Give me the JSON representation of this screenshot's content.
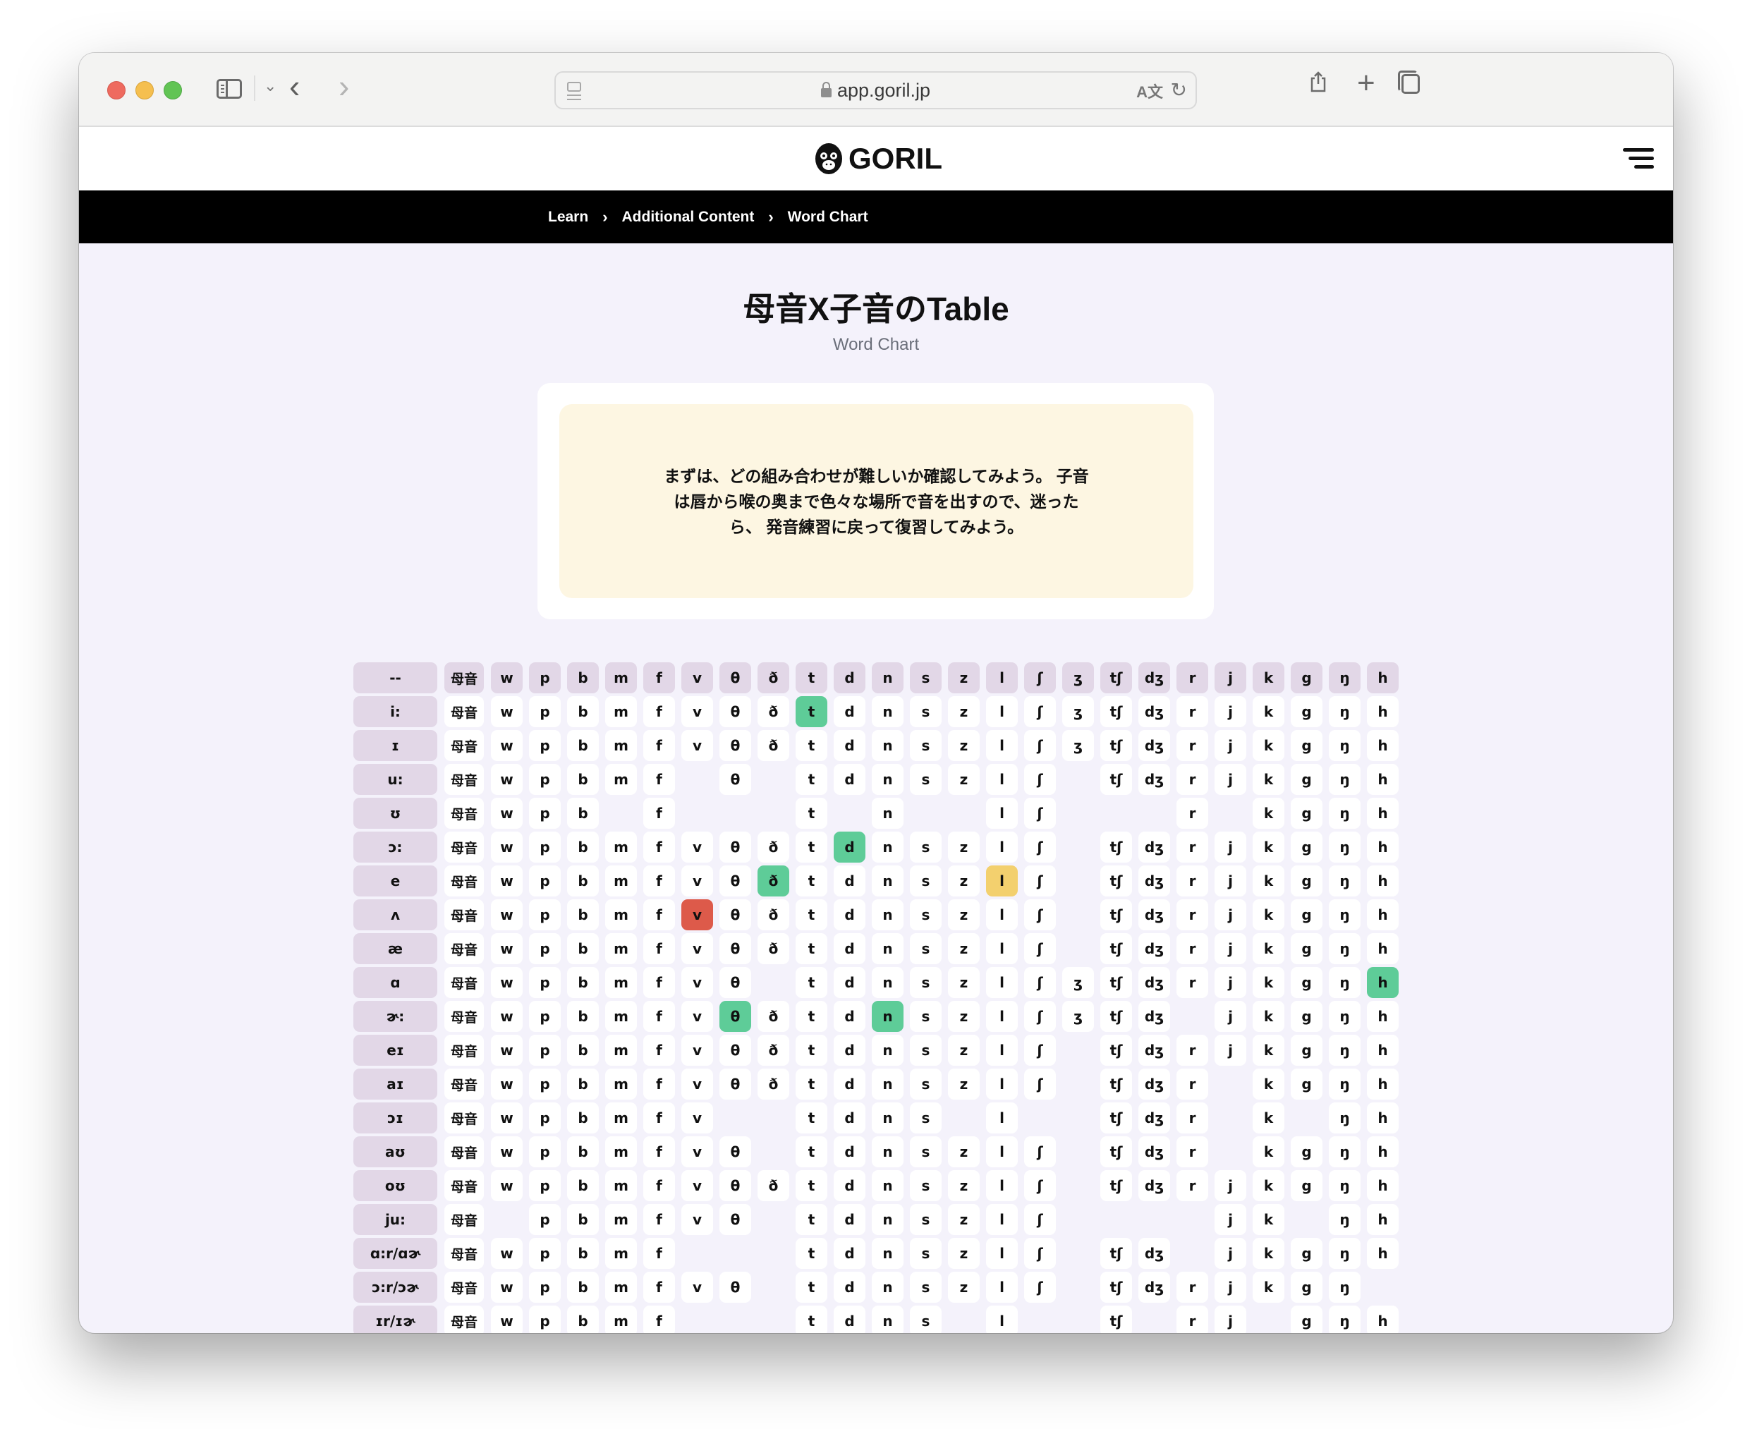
{
  "browser": {
    "url": "app.goril.jp",
    "icons": [
      "sidebar-icon",
      "chevron-down-icon",
      "back-icon",
      "forward-icon",
      "reader-icon",
      "lock-icon",
      "translate-icon",
      "reload-icon",
      "share-icon",
      "new-tab-icon",
      "tab-overview-icon"
    ]
  },
  "header": {
    "logo_text": "GORIL",
    "menu_icon": "hamburger-icon"
  },
  "breadcrumb": [
    {
      "label": "Learn"
    },
    {
      "label": "Additional Content"
    },
    {
      "label": "Word Chart"
    }
  ],
  "page": {
    "title": "母音X子音のTable",
    "subtitle": "Word Chart",
    "note": "まずは、どの組み合わせが難しいか確認してみよう。 子音は唇から喉の奥まで色々な場所で音を出すので、迷ったら、 発音練習に戻って復習してみよう。"
  },
  "colors": {
    "green": "#5ecc98",
    "yellow": "#f3d06e",
    "red": "#dd5a4a",
    "header_cell": "#e2d7e7",
    "page_bg": "#f4f2fb",
    "note_bg": "#fdf6e2"
  },
  "table": {
    "corner": "--",
    "columns": [
      "母音",
      "w",
      "p",
      "b",
      "m",
      "f",
      "v",
      "θ",
      "ð",
      "t",
      "d",
      "n",
      "s",
      "z",
      "l",
      "ʃ",
      "ʒ",
      "tʃ",
      "dʒ",
      "r",
      "j",
      "k",
      "g",
      "ŋ",
      "h"
    ],
    "rows": [
      {
        "vowel": "i:",
        "present": "1111111111111111111111111",
        "highlights": {
          "t": "green"
        }
      },
      {
        "vowel": "ɪ",
        "present": "1111111111111111111111111",
        "highlights": {}
      },
      {
        "vowel": "u:",
        "present": "1111110101111111011111111",
        "highlights": {}
      },
      {
        "vowel": "ʊ",
        "present": "1111010001010011000101111",
        "highlights": {}
      },
      {
        "vowel": "ɔ:",
        "present": "1111111111111111011111111",
        "highlights": {
          "d": "green"
        }
      },
      {
        "vowel": "e",
        "present": "1111111111111111011111111",
        "highlights": {
          "ð": "green",
          "l": "yellow"
        }
      },
      {
        "vowel": "ʌ",
        "present": "1111111111111111011111111",
        "highlights": {
          "v": "red"
        }
      },
      {
        "vowel": "æ",
        "present": "1111111111111111011111111",
        "highlights": {}
      },
      {
        "vowel": "ɑ",
        "present": "1111111101111111111111111",
        "highlights": {
          "h": "green"
        }
      },
      {
        "vowel": "ɚ:",
        "present": "1111111111111111111011111",
        "highlights": {
          "θ": "green",
          "n": "green"
        }
      },
      {
        "vowel": "eɪ",
        "present": "1111111111111111011111111",
        "highlights": {}
      },
      {
        "vowel": "aɪ",
        "present": "1111111111111111011101111",
        "highlights": {}
      },
      {
        "vowel": "ɔɪ",
        "present": "1111111001111010011101011",
        "highlights": {}
      },
      {
        "vowel": "aʊ",
        "present": "1111111101111111011101111",
        "highlights": {}
      },
      {
        "vowel": "oʊ",
        "present": "1111111111111111011111111",
        "highlights": {}
      },
      {
        "vowel": "ju:",
        "present": "1011111101111111000011011",
        "highlights": {}
      },
      {
        "vowel": "ɑ:r/ɑɚ",
        "present": "1111110001111111011011111",
        "highlights": {}
      },
      {
        "vowel": "ɔ:r/ɔɚ",
        "present": "1111111101111111011111110",
        "highlights": {}
      },
      {
        "vowel": "ɪr/ɪɚ",
        "present": "1111110001111010010110111",
        "highlights": {}
      }
    ]
  }
}
